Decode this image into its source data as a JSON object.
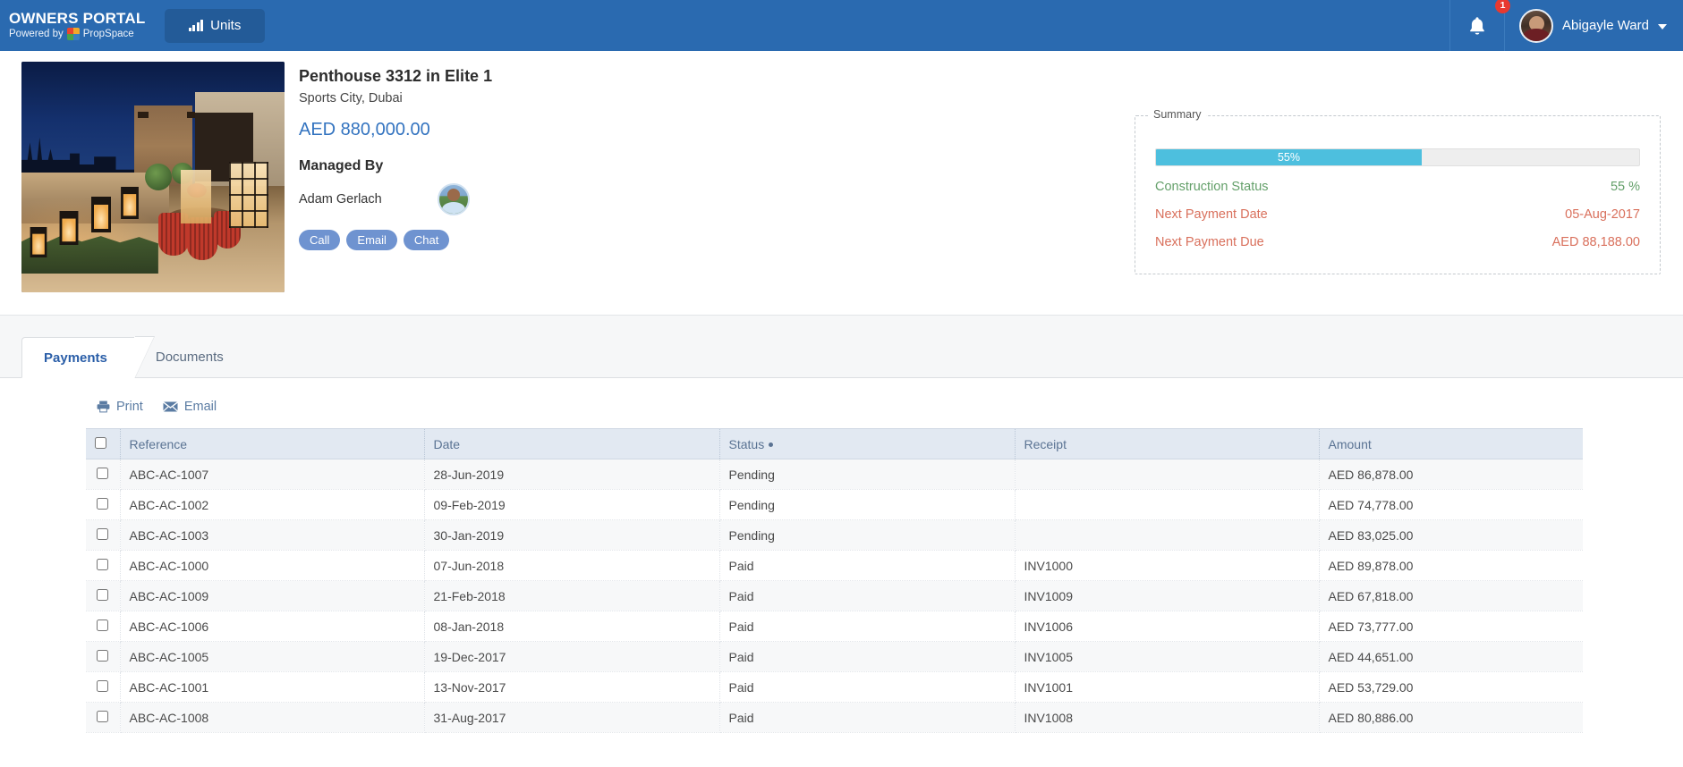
{
  "header": {
    "brand_title": "OWNERS PORTAL",
    "powered_by": "Powered by",
    "powered_by_brand": "PropSpace",
    "units_button": "Units",
    "notification_count": "1",
    "user_name": "Abigayle Ward",
    "accent_color": "#2a6ab0",
    "units_button_color": "#235b98",
    "badge_color": "#e8392f"
  },
  "property": {
    "title": "Penthouse 3312 in Elite 1",
    "location": "Sports City, Dubai",
    "price": "AED 880,000.00",
    "price_color": "#3474c0",
    "managed_by_label": "Managed By",
    "manager_name": "Adam Gerlach",
    "contact_buttons": [
      {
        "label": "Call"
      },
      {
        "label": "Email"
      },
      {
        "label": "Chat"
      }
    ],
    "contact_button_color": "#6f93d0"
  },
  "summary": {
    "legend": "Summary",
    "progress_percent": "55%",
    "progress_value": 55,
    "progress_color": "#4dbfde",
    "rows": [
      {
        "label": "Construction Status",
        "value": "55 %",
        "tone": "green",
        "color": "#64a06a"
      },
      {
        "label": "Next Payment Date",
        "value": "05-Aug-2017",
        "tone": "red",
        "color": "#d9705c"
      },
      {
        "label": "Next Payment Due",
        "value": "AED 88,188.00",
        "tone": "red",
        "color": "#d9705c"
      }
    ]
  },
  "tabs": [
    {
      "label": "Payments",
      "active": true
    },
    {
      "label": "Documents",
      "active": false
    }
  ],
  "toolbar": {
    "print_label": "Print",
    "email_label": "Email"
  },
  "table": {
    "columns": [
      "Reference",
      "Date",
      "Status",
      "Receipt",
      "Amount"
    ],
    "sorted_column": "Status",
    "rows": [
      {
        "reference": "ABC-AC-1007",
        "date": "28-Jun-2019",
        "status": "Pending",
        "receipt": "",
        "amount": "AED 86,878.00"
      },
      {
        "reference": "ABC-AC-1002",
        "date": "09-Feb-2019",
        "status": "Pending",
        "receipt": "",
        "amount": "AED 74,778.00"
      },
      {
        "reference": "ABC-AC-1003",
        "date": "30-Jan-2019",
        "status": "Pending",
        "receipt": "",
        "amount": "AED 83,025.00"
      },
      {
        "reference": "ABC-AC-1000",
        "date": "07-Jun-2018",
        "status": "Paid",
        "receipt": "INV1000",
        "amount": "AED 89,878.00"
      },
      {
        "reference": "ABC-AC-1009",
        "date": "21-Feb-2018",
        "status": "Paid",
        "receipt": "INV1009",
        "amount": "AED 67,818.00"
      },
      {
        "reference": "ABC-AC-1006",
        "date": "08-Jan-2018",
        "status": "Paid",
        "receipt": "INV1006",
        "amount": "AED 73,777.00"
      },
      {
        "reference": "ABC-AC-1005",
        "date": "19-Dec-2017",
        "status": "Paid",
        "receipt": "INV1005",
        "amount": "AED 44,651.00"
      },
      {
        "reference": "ABC-AC-1001",
        "date": "13-Nov-2017",
        "status": "Paid",
        "receipt": "INV1001",
        "amount": "AED 53,729.00"
      },
      {
        "reference": "ABC-AC-1008",
        "date": "31-Aug-2017",
        "status": "Paid",
        "receipt": "INV1008",
        "amount": "AED 80,886.00"
      }
    ]
  },
  "icons": {
    "units": "bar-chart-icon",
    "notifications": "bell-icon",
    "user_menu": "chevron-down-icon",
    "print": "printer-icon",
    "email": "envelope-icon",
    "brand": "propspace-logo-icon"
  }
}
